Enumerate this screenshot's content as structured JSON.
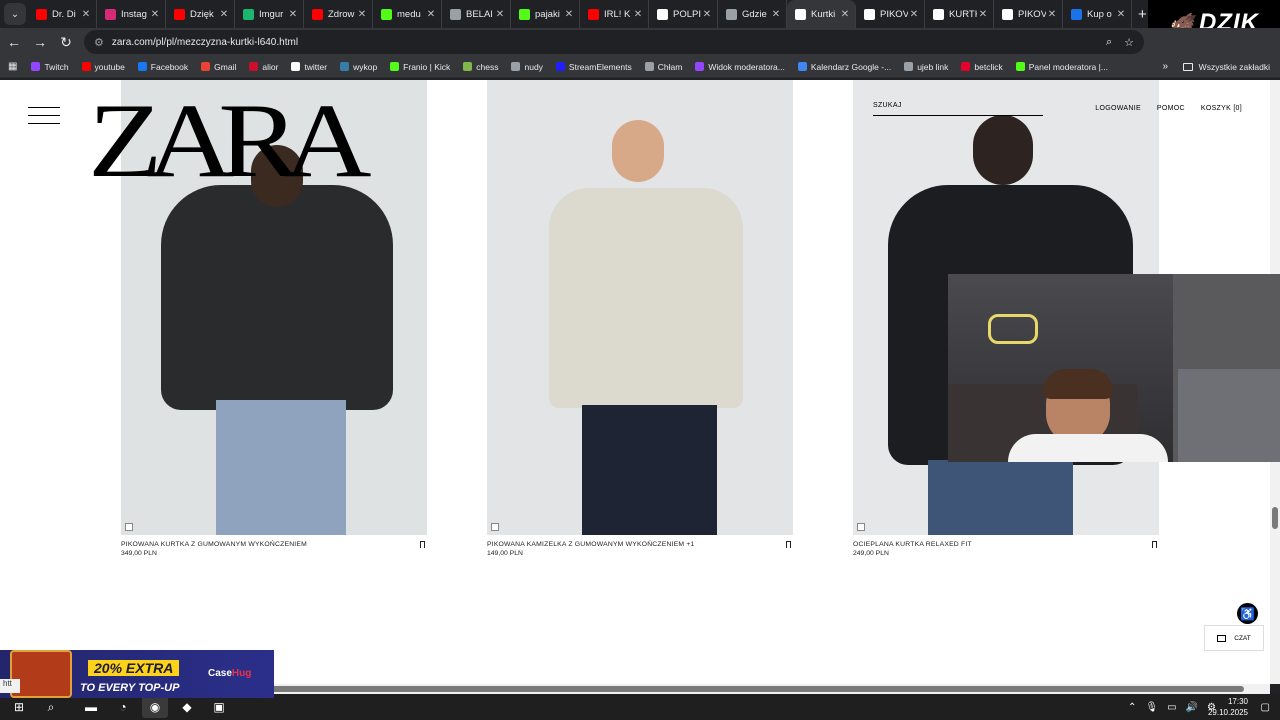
{
  "browser": {
    "tabs": [
      {
        "label": "Dr. Di",
        "color": "#ff0000"
      },
      {
        "label": "Instag",
        "color": "#d62976"
      },
      {
        "label": "Dzięk",
        "color": "#ff0000"
      },
      {
        "label": "Imgur",
        "color": "#1bb76e"
      },
      {
        "label": "Zdrow",
        "color": "#ff0000"
      },
      {
        "label": "medu",
        "color": "#53fc18"
      },
      {
        "label": "BELAI",
        "color": "#9aa0a6"
      },
      {
        "label": "pajaki",
        "color": "#53fc18"
      },
      {
        "label": "IRL! K",
        "color": "#ff0000"
      },
      {
        "label": "POLPI",
        "color": "#ffffff"
      },
      {
        "label": "Gdzie",
        "color": "#9aa0a6"
      },
      {
        "label": "Kurtki",
        "color": "#ffffff"
      },
      {
        "label": "PIKOV",
        "color": "#ffffff"
      },
      {
        "label": "KURTK",
        "color": "#ffffff"
      },
      {
        "label": "PIKOV",
        "color": "#ffffff"
      },
      {
        "label": "Kup o",
        "color": "#1a73e8"
      }
    ],
    "active_tab_index": 11,
    "new_tab_label": "+",
    "url": "zara.com/pl/pl/mezczyzna-kurtki-l640.html",
    "bookmarks": [
      {
        "label": "Twitch",
        "color": "#9146ff"
      },
      {
        "label": "youtube",
        "color": "#ff0000"
      },
      {
        "label": "Facebook",
        "color": "#1877f2"
      },
      {
        "label": "Gmail",
        "color": "#ea4335"
      },
      {
        "label": "alior",
        "color": "#c8102e"
      },
      {
        "label": "twitter",
        "color": "#ffffff"
      },
      {
        "label": "wykop",
        "color": "#367da9"
      },
      {
        "label": "Franio | Kick",
        "color": "#53fc18"
      },
      {
        "label": "chess",
        "color": "#81b64c"
      },
      {
        "label": "nudy",
        "color": "#9aa0a6"
      },
      {
        "label": "StreamElements",
        "color": "#1f1fff"
      },
      {
        "label": "Chłam",
        "color": "#9aa0a6"
      },
      {
        "label": "Widok moderatora...",
        "color": "#9146ff"
      },
      {
        "label": "Kalendarz Google -...",
        "color": "#4285f4"
      },
      {
        "label": "ujeb link",
        "color": "#9aa0a6"
      },
      {
        "label": "betclick",
        "color": "#e4002b"
      },
      {
        "label": "Panel moderatora |...",
        "color": "#53fc18"
      }
    ],
    "all_bookmarks": "Wszystkie zakładki"
  },
  "overlay": {
    "brand": "DZIK"
  },
  "site": {
    "logo": "ZARA",
    "search": "SZUKAJ",
    "nav": [
      "LOGOWANIE",
      "POMOC",
      "KOSZYK [0]"
    ],
    "products": [
      {
        "name": "PIKOWANA KURTKA Z GUMOWANYM WYKOŃCZENIEM",
        "price": "349,00 PLN",
        "extra": ""
      },
      {
        "name": "PIKOWANA KAMIZELKA Z GUMOWANYM WYKOŃCZENIEM",
        "price": "149,00 PLN",
        "extra": "+1"
      },
      {
        "name": "OCIEPLANA KURTKA RELAXED FIT",
        "price": "249,00 PLN",
        "extra": ""
      }
    ],
    "chat": "CZAT"
  },
  "ad": {
    "line1": "20% EXTRA",
    "line2": "TO EVERY TOP-UP",
    "brand_a": "Case",
    "brand_b": "Hug"
  },
  "status_link": "htt",
  "taskbar": {
    "time": "17:30",
    "date": "29.10.2025"
  }
}
